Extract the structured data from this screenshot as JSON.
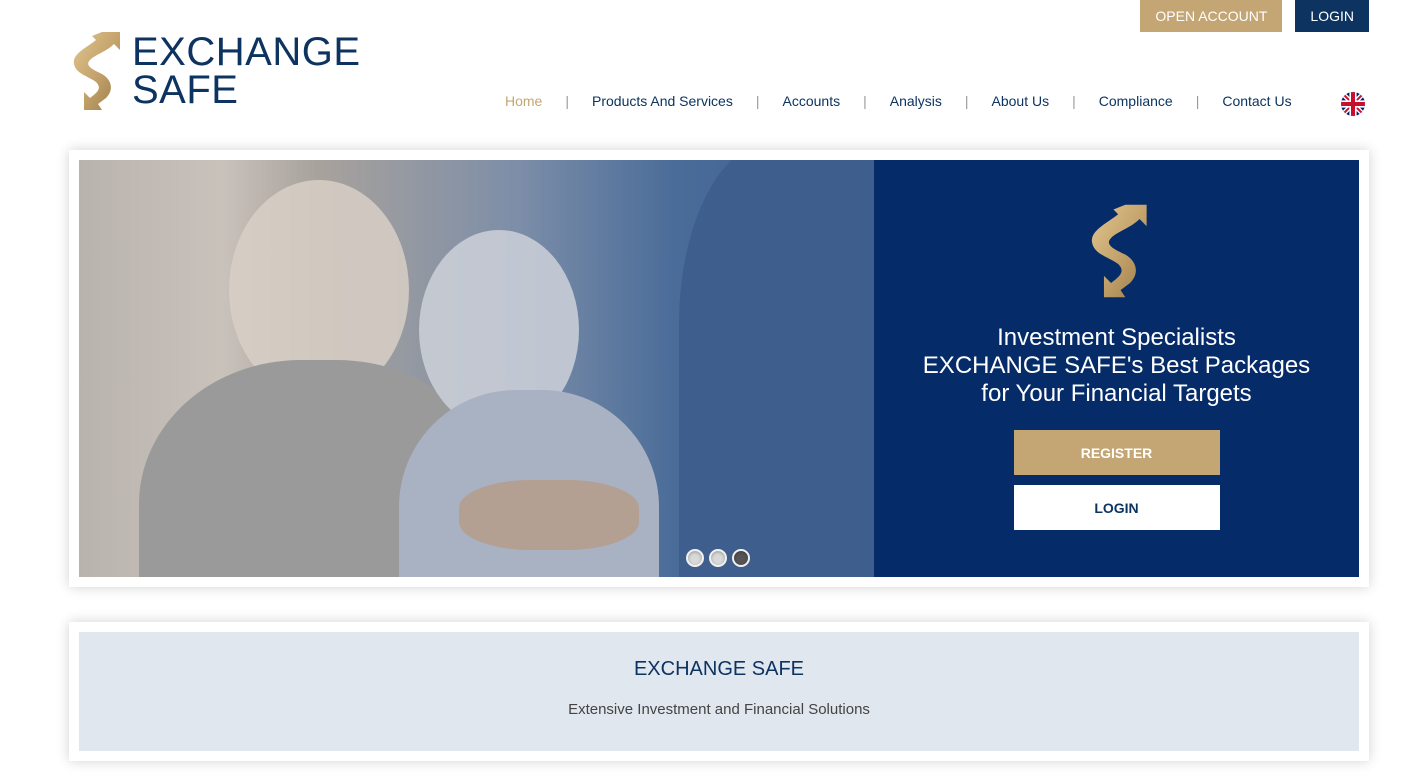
{
  "header": {
    "logo": {
      "line1": "EXCHANGE",
      "line2": "SAFE",
      "icon": "double-arrow-s-icon"
    },
    "top_actions": {
      "open_account": "OPEN ACCOUNT",
      "login": "LOGIN"
    },
    "nav": [
      {
        "label": "Home",
        "active": true
      },
      {
        "label": "Products And Services",
        "active": false
      },
      {
        "label": "Accounts",
        "active": false
      },
      {
        "label": "Analysis",
        "active": false
      },
      {
        "label": "About Us",
        "active": false
      },
      {
        "label": "Compliance",
        "active": false
      },
      {
        "label": "Contact Us",
        "active": false
      }
    ],
    "nav_separator": "|",
    "language_icon": "uk-flag-icon"
  },
  "hero": {
    "title": "Investment Specialists",
    "subtitle_line1": "EXCHANGE SAFE's Best Packages",
    "subtitle_line2": "for Your Financial Targets",
    "register_label": "REGISTER",
    "login_label": "LOGIN",
    "slides": {
      "count": 3,
      "active_index": 2
    },
    "image_alt": "Smiling senior couple shaking hands with advisor"
  },
  "info": {
    "title": "EXCHANGE SAFE",
    "subtitle": "Extensive Investment and Financial Solutions"
  },
  "colors": {
    "brand_navy": "#0d3461",
    "hero_navy": "#052c69",
    "gold": "#c4a574",
    "info_bg": "#e1e7ef"
  }
}
